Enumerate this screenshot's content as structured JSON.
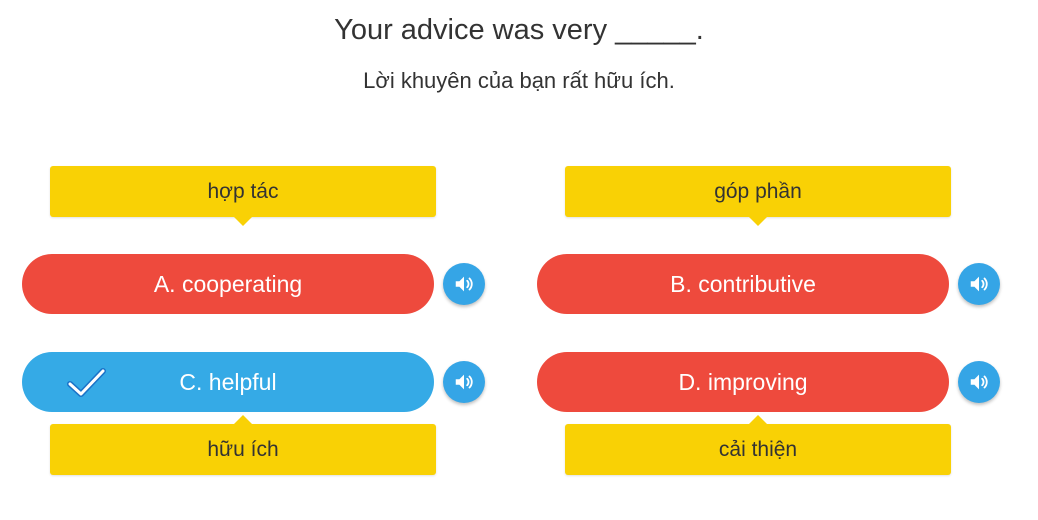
{
  "question": {
    "sentence": "Your advice was very _____.",
    "translation": "Lời khuyên của bạn rất hữu ích."
  },
  "options": [
    {
      "label": "A. cooperating",
      "hint": "hợp tác",
      "selected": false
    },
    {
      "label": "B. contributive",
      "hint": "góp phần",
      "selected": false
    },
    {
      "label": "C. helpful",
      "hint": "hữu ích",
      "selected": true
    },
    {
      "label": "D. improving",
      "hint": "cải thiện",
      "selected": false
    }
  ],
  "colors": {
    "option_default": "#ee4a3d",
    "option_selected": "#35aae6",
    "hint_background": "#f9d105",
    "audio_button": "#35a5e6"
  },
  "icons": {
    "audio": "speaker-icon",
    "selected": "checkmark-icon"
  }
}
